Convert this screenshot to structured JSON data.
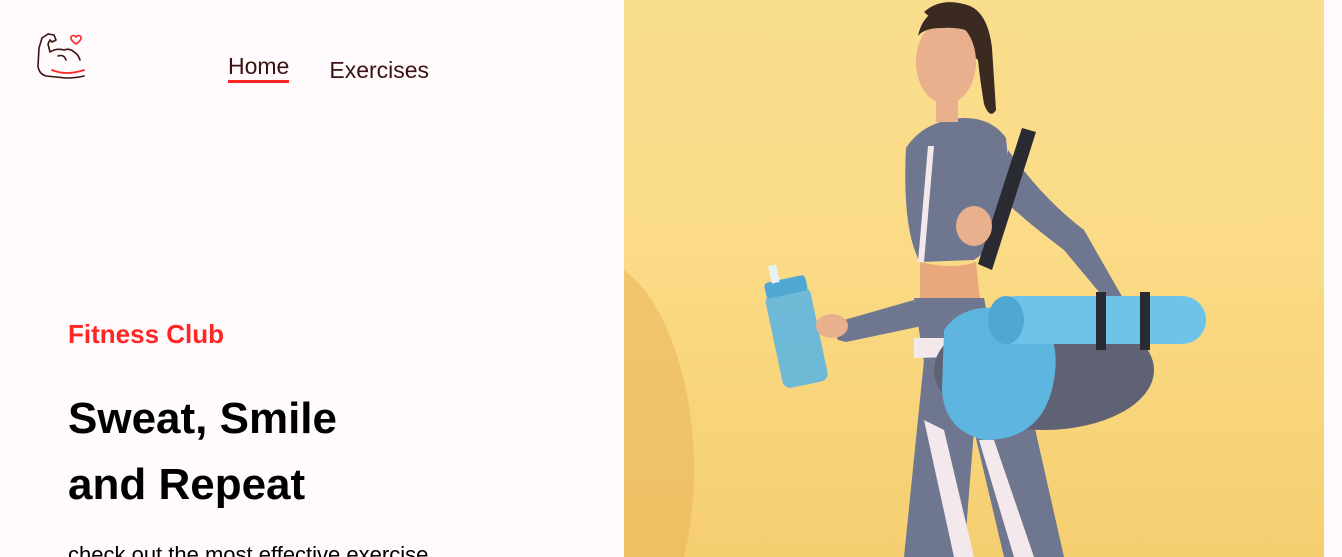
{
  "header": {
    "logo_icon": "flexed-arm-heart-icon",
    "nav": [
      {
        "label": "Home",
        "active": true
      },
      {
        "label": "Exercises",
        "active": false
      }
    ]
  },
  "hero": {
    "tagline": "Fitness Club",
    "headline_line1": "Sweat, Smile",
    "headline_line2": "and Repeat",
    "description": "check out the most effective exercise",
    "image_description": "woman-walking-with-yoga-mat-bag-and-water-bottle"
  },
  "colors": {
    "accent": "#FF2625",
    "nav_text": "#3A1212",
    "background": "#FFFAFB",
    "hero_bg": "#FBDB86"
  }
}
